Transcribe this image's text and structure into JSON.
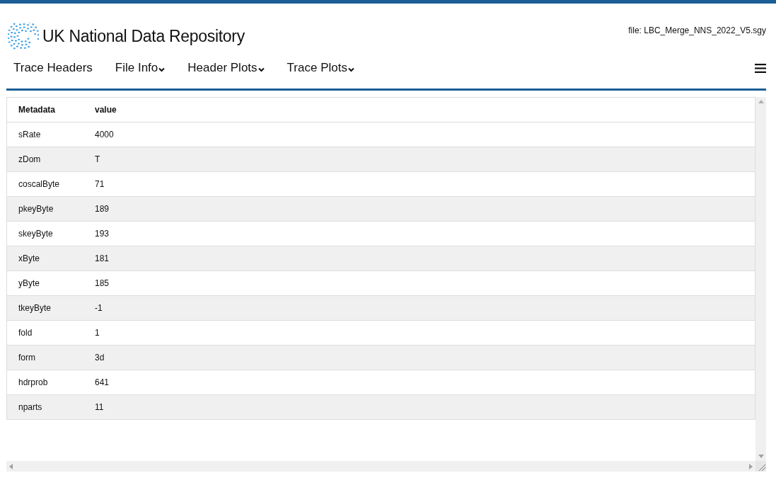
{
  "header": {
    "title": "UK National Data Repository",
    "file_label": "file: LBC_Merge_NNS_2022_V5.sgy"
  },
  "nav": [
    {
      "label": "Trace Headers",
      "kind": "link"
    },
    {
      "label": "File Info",
      "kind": "dropdown"
    },
    {
      "label": "Header Plots",
      "kind": "dropdown"
    },
    {
      "label": "Trace Plots",
      "kind": "dropdown"
    }
  ],
  "table": {
    "columns": [
      "Metadata",
      "value"
    ],
    "rows": [
      [
        "sRate",
        "4000"
      ],
      [
        "zDom",
        "T"
      ],
      [
        "coscalByte",
        "71"
      ],
      [
        "pkeyByte",
        "189"
      ],
      [
        "skeyByte",
        "193"
      ],
      [
        "xByte",
        "181"
      ],
      [
        "yByte",
        "185"
      ],
      [
        "tkeyByte",
        "-1"
      ],
      [
        "fold",
        "1"
      ],
      [
        "form",
        "3d"
      ],
      [
        "hdrprob",
        "641"
      ],
      [
        "nparts",
        "11"
      ]
    ]
  }
}
